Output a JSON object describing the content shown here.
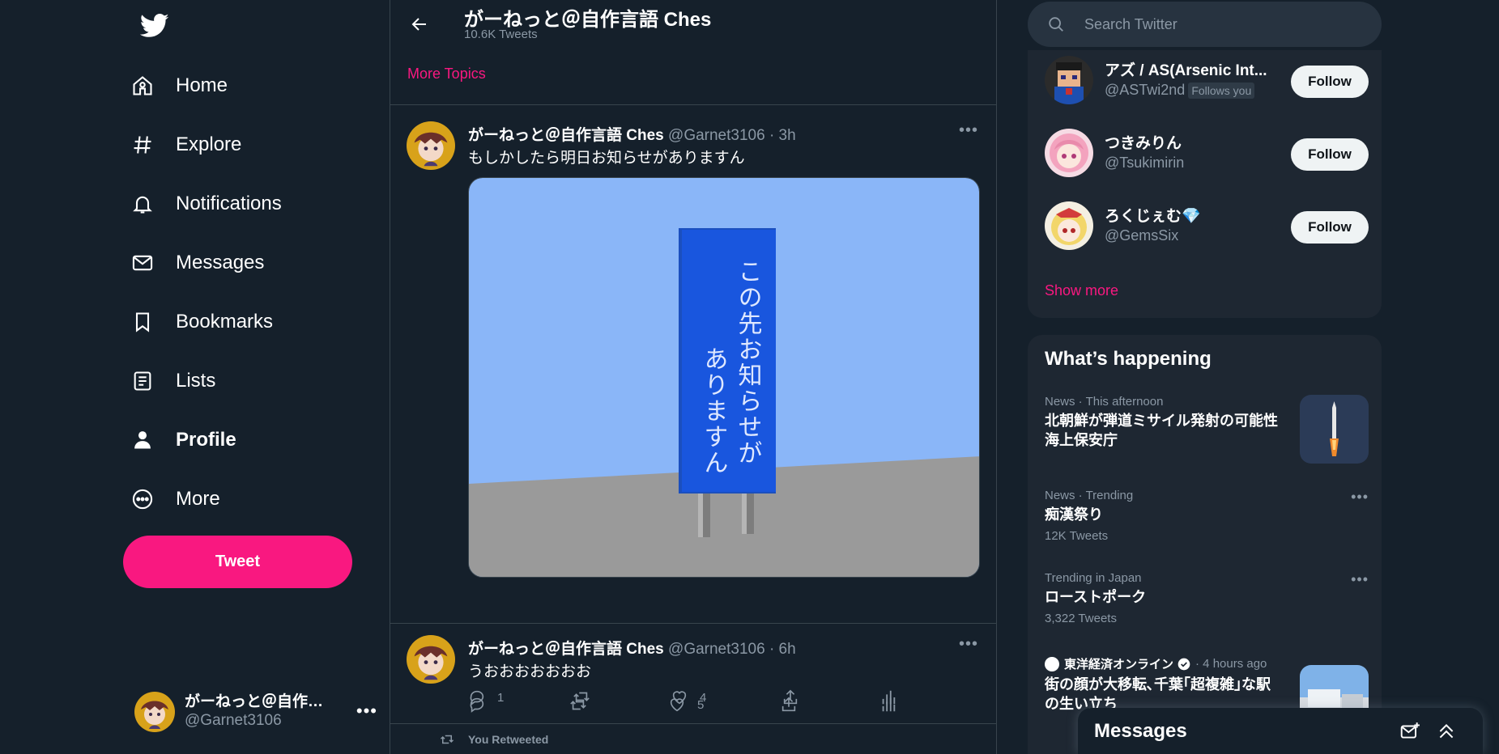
{
  "nav": {
    "items": [
      {
        "label": "Home",
        "icon": "home-icon"
      },
      {
        "label": "Explore",
        "icon": "hashtag-icon"
      },
      {
        "label": "Notifications",
        "icon": "bell-icon"
      },
      {
        "label": "Messages",
        "icon": "envelope-icon"
      },
      {
        "label": "Bookmarks",
        "icon": "bookmark-icon"
      },
      {
        "label": "Lists",
        "icon": "list-icon"
      },
      {
        "label": "Profile",
        "icon": "person-icon"
      },
      {
        "label": "More",
        "icon": "more-circle-icon"
      }
    ],
    "active": "Profile",
    "tweet_button": "Tweet"
  },
  "account": {
    "display_name": "がーねっと＠自作…",
    "handle": "@Garnet3106"
  },
  "header": {
    "title": "がーねっと＠自作言語 Ches",
    "subtitle": "10.6K Tweets",
    "more_topics": "More Topics"
  },
  "tweets": [
    {
      "name": "がーねっと＠自作言語 Ches",
      "handle": "@Garnet3106",
      "time": "· 3h",
      "text": "もしかしたら明日お知らせがありますん",
      "image_sign_text_right": "この先お知らせが",
      "image_sign_text_left": "ありますん",
      "replies": "",
      "retweets": "",
      "likes": "5"
    },
    {
      "name": "がーねっと＠自作言語 Ches",
      "handle": "@Garnet3106",
      "time": "· 6h",
      "text": "うおおおおおおお",
      "replies": "1",
      "retweets": "",
      "likes": "4"
    }
  ],
  "retweet_note": "You Retweeted",
  "search": {
    "placeholder": "Search Twitter"
  },
  "who_to_follow": {
    "items": [
      {
        "name": "アズ / AS(Arsenic Int...",
        "handle": "@ASTwi2nd",
        "badge": "Follows you",
        "button": "Follow"
      },
      {
        "name": "つきみりん",
        "handle": "@Tsukimirin",
        "badge": "",
        "button": "Follow"
      },
      {
        "name": "ろくじぇむ💎",
        "handle": "@GemsSix",
        "badge": "",
        "button": "Follow"
      }
    ],
    "show_more": "Show more"
  },
  "trends": {
    "title": "What’s happening",
    "items": [
      {
        "meta": "News · This afternoon",
        "title": "北朝鮮が弾道ミサイル発射の可能性 海上保安庁",
        "count": ""
      },
      {
        "meta": "News · Trending",
        "title": "痴漢祭り",
        "count": "12K Tweets"
      },
      {
        "meta": "Trending in Japan",
        "title": "ローストポーク",
        "count": "3,322 Tweets"
      },
      {
        "meta": "東洋経済オンライン",
        "meta_time": "· 4 hours ago",
        "title": "街の顔が大移転､千葉｢超複雑｣な駅の生い立ち",
        "count": ""
      }
    ]
  },
  "messages_drawer": {
    "title": "Messages"
  },
  "colors": {
    "accent": "#f91880",
    "background": "#15202b",
    "panel": "#1e2732",
    "muted": "#8b98a5"
  }
}
